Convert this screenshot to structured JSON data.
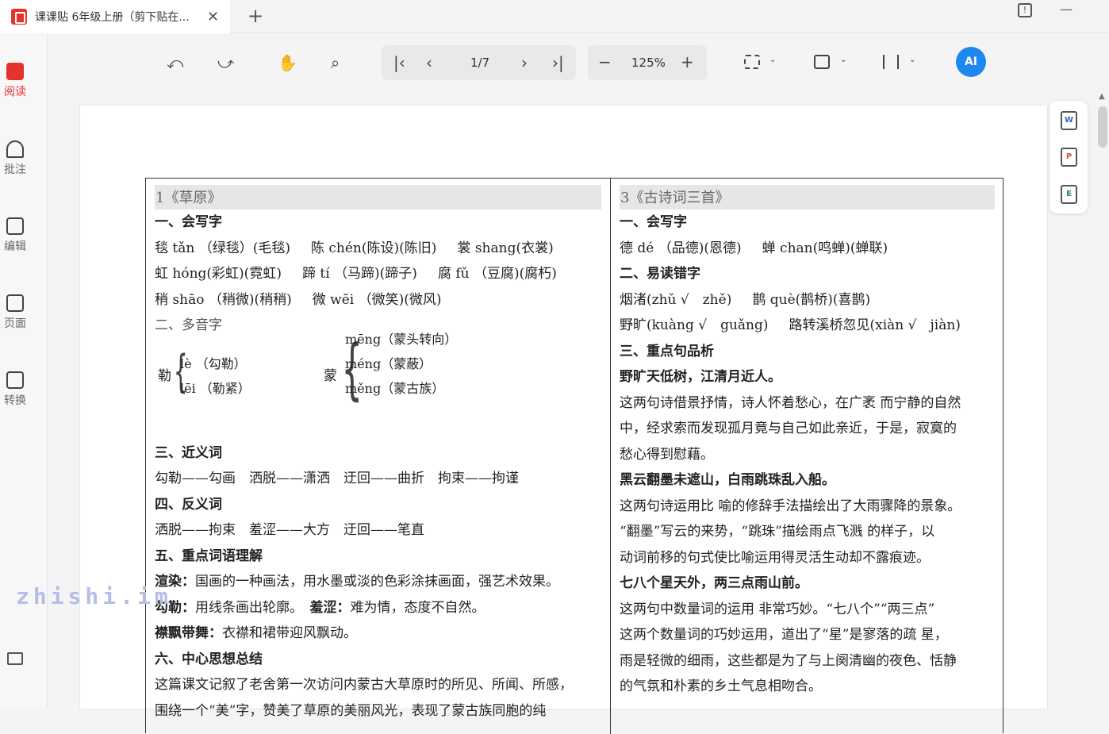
{
  "tab": {
    "title": "课课贴 6年级上册（剪下贴在...",
    "close": "✕",
    "add": "+"
  },
  "window": {
    "feedback": "!",
    "minimize": "—"
  },
  "rail": {
    "items": [
      {
        "label": "阅读"
      },
      {
        "label": "批注"
      },
      {
        "label": "编辑"
      },
      {
        "label": "页面"
      },
      {
        "label": "转换"
      }
    ]
  },
  "toolbar": {
    "page": "1/7",
    "zoom": "125%",
    "ai": "AI"
  },
  "colors": {
    "accent": "#e5322d",
    "ai": "#1e88f0"
  },
  "left": {
    "heading": "1《草原》",
    "s1": "一、会写字",
    "s1_rows": [
      [
        "毯 tǎn （绿毯）(毛毯)",
        "陈 chén(陈设)(陈旧)",
        "裳 shang(衣裳)"
      ],
      [
        "虹 hóng(彩虹)(霓虹)",
        "蹄 tí （马蹄)(蹄子)",
        "腐 fǔ （豆腐)(腐朽)"
      ],
      [
        "稍 shāo （稍微)(稍稍)",
        "微 wēi （微笑)(微风)"
      ]
    ],
    "s2": "二、多音字",
    "poly1": {
      "char": "勒",
      "lines": [
        "lè （勾勒）",
        "lēi （勒紧）"
      ]
    },
    "poly2": {
      "char": "蒙",
      "lines": [
        "mēng（蒙头转向）",
        "méng（蒙蔽）",
        "měng（蒙古族）"
      ]
    },
    "s3": "三、近义词",
    "s3_text": "勾勒——勾画　洒脱——潇洒　迂回——曲折　拘束——拘谨",
    "s4": "四、反义词",
    "s4_text": "洒脱——拘束　羞涩——大方　迂回——笔直",
    "s5": "五、重点词语理解",
    "s5_l1_term": "渲染：",
    "s5_l1_def": "国画的一种画法，用水墨或淡的色彩涂抹画面，强艺术效果。",
    "s5_l2_term": "勾勒：",
    "s5_l2_def": "用线条画出轮廓。",
    "s5_l2_term2": "羞涩：",
    "s5_l2_def2": "难为情，态度不自然。",
    "s5_l3_term": "襟飘带舞：",
    "s5_l3_def": "衣襟和裙带迎风飘动。",
    "s6": "六、中心思想总结",
    "s6_l1": "这篇课文记叙了老舍第一次访问内蒙古大草原时的所见、所闻、所感，",
    "s6_l2": "围绕一个“美”字，赞美了草原的美丽风光，表现了蒙古族同胞的纯"
  },
  "right": {
    "heading": "3《古诗词三首》",
    "s1": "一、会写字",
    "s1_row": [
      "德 dé （品德)(恩德)",
      "蝉 chan(鸣蝉)(蝉联)"
    ],
    "s2": "二、易读错字",
    "s2_rows": [
      [
        "烟渚(zhǔ √　zhě)",
        "鹊 què(鹊桥)(喜鹊)"
      ],
      [
        "野旷(kuàng √　guǎng)",
        "路转溪桥忽见(xiàn √　jiàn)"
      ]
    ],
    "s3": "三、重点句品析",
    "q1": "野旷天低树，江清月近人。",
    "q1_l1": "这两句诗借景抒情，诗人怀着愁心，在广袤 而宁静的自然",
    "q1_l2": "中，经求索而发现孤月竟与自己如此亲近，于是，寂寞的",
    "q1_l3": "愁心得到慰藉。",
    "q2": "黑云翻墨未遮山，白雨跳珠乱入船。",
    "q2_l1": "这两句诗运用比 喻的修辞手法描绘出了大雨骤降的景象。",
    "q2_l2": "“翻墨”写云的来势，“跳珠”描绘雨点飞溅 的样子，以",
    "q2_l3": "动词前移的句式使比喻运用得灵活生动却不露痕迹。",
    "q3": "七八个星天外，两三点雨山前。",
    "q3_l1": "这两句中数量词的运用 非常巧妙。“七八个”“两三点”",
    "q3_l2": "这两个数量词的巧妙运用，道出了“星”是寥落的疏 星，",
    "q3_l3": "雨是轻微的细雨，这些都是为了与上阕清幽的夜色、恬静",
    "q3_l4": "的气氛和朴素的乡土气息相吻合。"
  },
  "float": {
    "word": "W",
    "ppt": "P",
    "excel": "E"
  },
  "watermark": "zhishi.im"
}
